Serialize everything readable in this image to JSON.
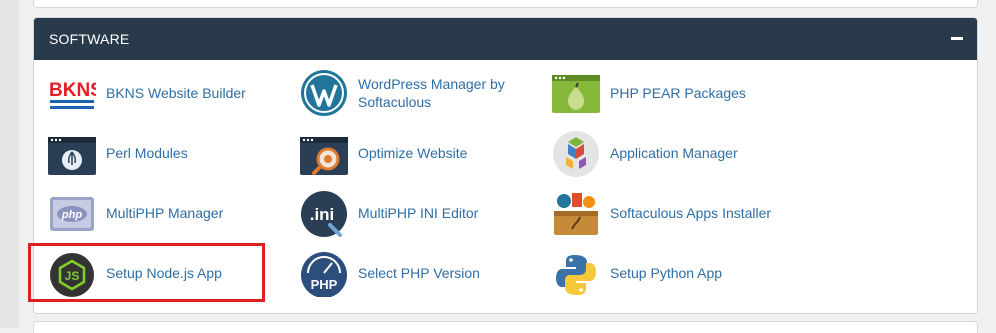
{
  "panel": {
    "title": "SOFTWARE",
    "collapse_symbol": "−"
  },
  "items": [
    {
      "label": "BKNS Website Builder",
      "icon": "bkns-icon"
    },
    {
      "label": "WordPress Manager by Softaculous",
      "icon": "wordpress-icon"
    },
    {
      "label": "PHP PEAR Packages",
      "icon": "pear-icon"
    },
    {
      "label": "Perl Modules",
      "icon": "perl-icon"
    },
    {
      "label": "Optimize Website",
      "icon": "optimize-icon"
    },
    {
      "label": "Application Manager",
      "icon": "application-manager-icon"
    },
    {
      "label": "MultiPHP Manager",
      "icon": "multiphp-icon"
    },
    {
      "label": "MultiPHP INI Editor",
      "icon": "ini-editor-icon"
    },
    {
      "label": "Softaculous Apps Installer",
      "icon": "softaculous-icon"
    },
    {
      "label": "Setup Node.js App",
      "icon": "nodejs-icon"
    },
    {
      "label": "Select PHP Version",
      "icon": "php-version-icon"
    },
    {
      "label": "Setup Python App",
      "icon": "python-icon"
    }
  ],
  "logo": {
    "bkns_text": "BKNS"
  },
  "icon_text": {
    "php": "php",
    "ini": ".ini",
    "js": "JS",
    "php_version": "PHP"
  },
  "colors": {
    "header": "#293a4a",
    "link": "#2f6ea5",
    "highlight": "#e02020"
  }
}
